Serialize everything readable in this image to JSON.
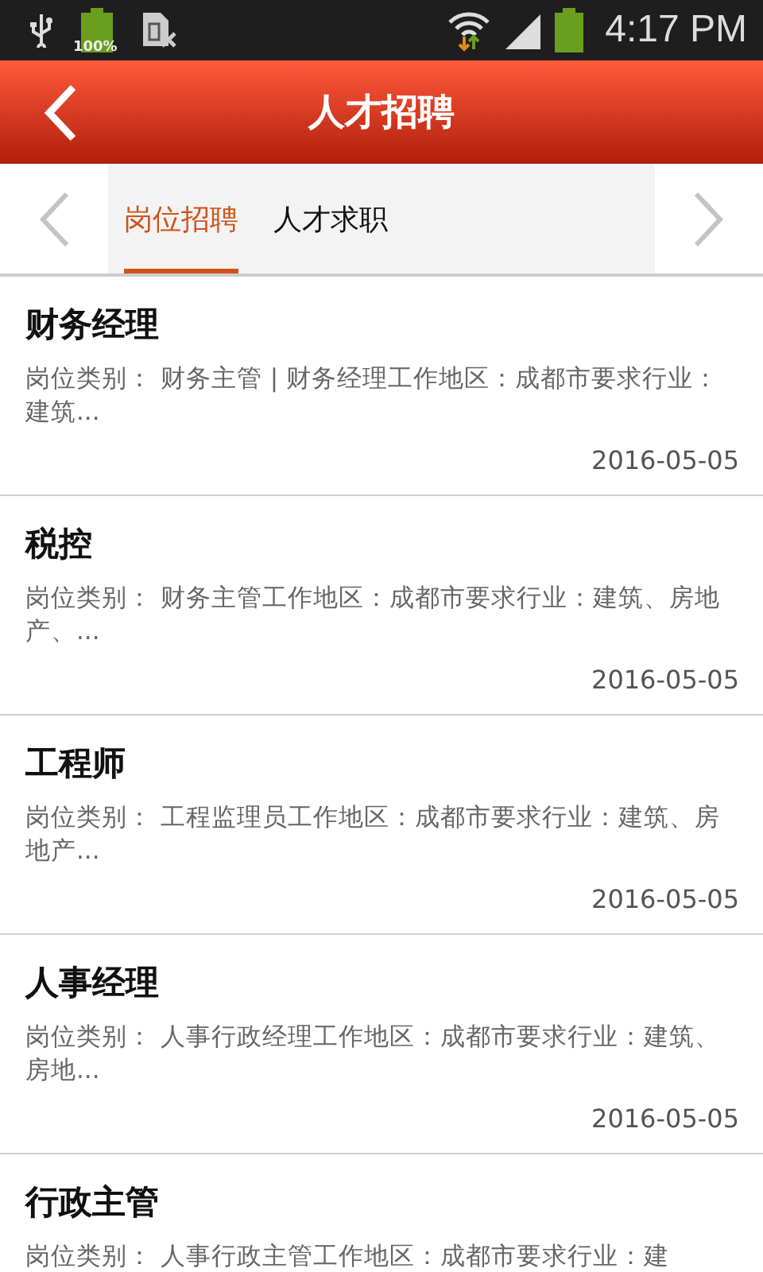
{
  "status_bar": {
    "battery_label": "100%",
    "time": "4:17 PM"
  },
  "header": {
    "title": "人才招聘"
  },
  "tabs": [
    {
      "label": "岗位招聘",
      "selected": true
    },
    {
      "label": "人才求职",
      "selected": false
    }
  ],
  "jobs": [
    {
      "title": "财务经理",
      "summary": "岗位类别： 财务主管 | 财务经理工作地区：成都市要求行业：建筑...",
      "date": "2016-05-05"
    },
    {
      "title": "税控",
      "summary": "岗位类别： 财务主管工作地区：成都市要求行业：建筑、房地产、...",
      "date": "2016-05-05"
    },
    {
      "title": "工程师",
      "summary": "岗位类别： 工程监理员工作地区：成都市要求行业：建筑、房地产...",
      "date": "2016-05-05"
    },
    {
      "title": "人事经理",
      "summary": "岗位类别： 人事行政经理工作地区：成都市要求行业：建筑、房地...",
      "date": "2016-05-05"
    },
    {
      "title": "行政主管",
      "summary": "岗位类别： 人事行政主管工作地区：成都市要求行业：建"
    }
  ]
}
